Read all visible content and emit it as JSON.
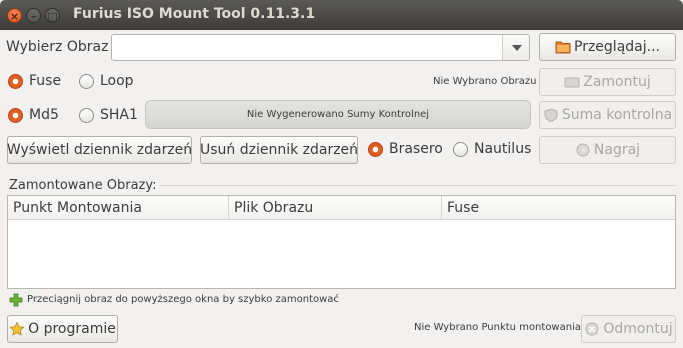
{
  "window": {
    "title": "Furius ISO Mount Tool 0.11.3.1"
  },
  "image_select": {
    "label": "Wybierz Obraz",
    "value": "",
    "browse_button": "Przeglądaj..."
  },
  "mount_mode": {
    "fuse_label": "Fuse",
    "loop_label": "Loop",
    "selected": "Fuse",
    "status": "Nie Wybrano Obrazu",
    "mount_button": "Zamontuj"
  },
  "checksum": {
    "md5_label": "Md5",
    "sha1_label": "SHA1",
    "selected": "Md5",
    "status": "Nie Wygenerowano Sumy Kontrolnej",
    "button": "Suma kontrolna"
  },
  "log": {
    "show_button": "Wyświetl dziennik zdarzeń",
    "delete_button": "Usuń dziennik zdarzeń"
  },
  "burner": {
    "brasero_label": "Brasero",
    "nautilus_label": "Nautilus",
    "selected": "Brasero",
    "burn_button": "Nagraj"
  },
  "mounted": {
    "group_title": "Zamontowane Obrazy:",
    "columns": [
      "Punkt Montowania",
      "Plik Obrazu",
      "Fuse"
    ],
    "rows": []
  },
  "hint": "Przeciągnij obraz do powyższego okna by szybko zamontować",
  "footer": {
    "about_button": "O programie",
    "status": "Nie Wybrano Punktu montowania",
    "unmount_button": "Odmontuj"
  },
  "colors": {
    "accent": "#e2601f",
    "titlebar": "#3d3c38",
    "background": "#f2f1f0"
  }
}
